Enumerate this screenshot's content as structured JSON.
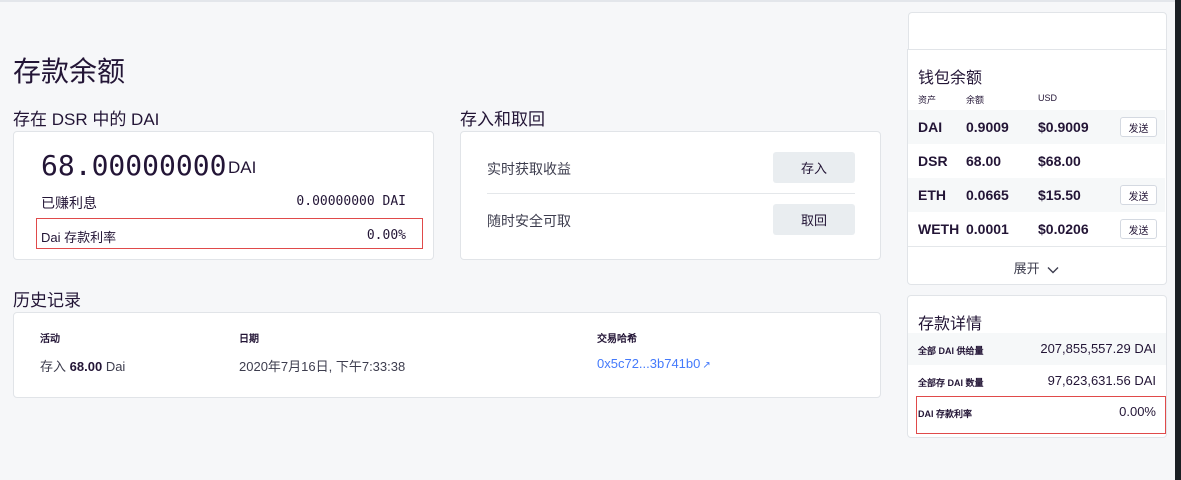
{
  "page_title": "存款余额",
  "dsr": {
    "section_title": "存在 DSR 中的 DAI",
    "amount": "68.00000000",
    "unit": "DAI",
    "interest_label": "已赚利息",
    "interest_value": "0.00000000 DAI",
    "rate_label": "Dai 存款利率",
    "rate_value": "0.00%"
  },
  "deposit": {
    "section_title": "存入和取回",
    "row1_label": "实时获取收益",
    "row1_button": "存入",
    "row2_label": "随时安全可取",
    "row2_button": "取回"
  },
  "history": {
    "section_title": "历史记录",
    "columns": [
      "活动",
      "日期",
      "交易哈希"
    ],
    "rows": [
      {
        "action_prefix": "存入",
        "amount": "68.00",
        "unit": "Dai",
        "date": "2020年7月16日, 下午7:33:38",
        "hash": "0x5c72...3b741b0",
        "hash_icon": "↗"
      }
    ]
  },
  "wallet": {
    "title": "钱包余额",
    "columns": [
      "资产",
      "余额",
      "USD"
    ],
    "rows": [
      {
        "asset": "DAI",
        "balance": "0.9009",
        "usd": "$0.9009",
        "send": "发送"
      },
      {
        "asset": "DSR",
        "balance": "68.00",
        "usd": "$68.00",
        "send": ""
      },
      {
        "asset": "ETH",
        "balance": "0.0665",
        "usd": "$15.50",
        "send": "发送"
      },
      {
        "asset": "WETH",
        "balance": "0.0001",
        "usd": "$0.0206",
        "send": "发送"
      }
    ],
    "expand_label": "展开",
    "expand_icon": "chevron-down-icon"
  },
  "details": {
    "title": "存款详情",
    "rows": [
      {
        "label": "全部 DAI 供给量",
        "value": "207,855,557.29 DAI"
      },
      {
        "label": "全部存 DAI 数量",
        "value": "97,623,631.56 DAI"
      },
      {
        "label": "DAI 存款利率",
        "value": "0.00%"
      }
    ]
  },
  "colors": {
    "accent_link": "#447afb",
    "highlight_border": "#e04a4a"
  }
}
